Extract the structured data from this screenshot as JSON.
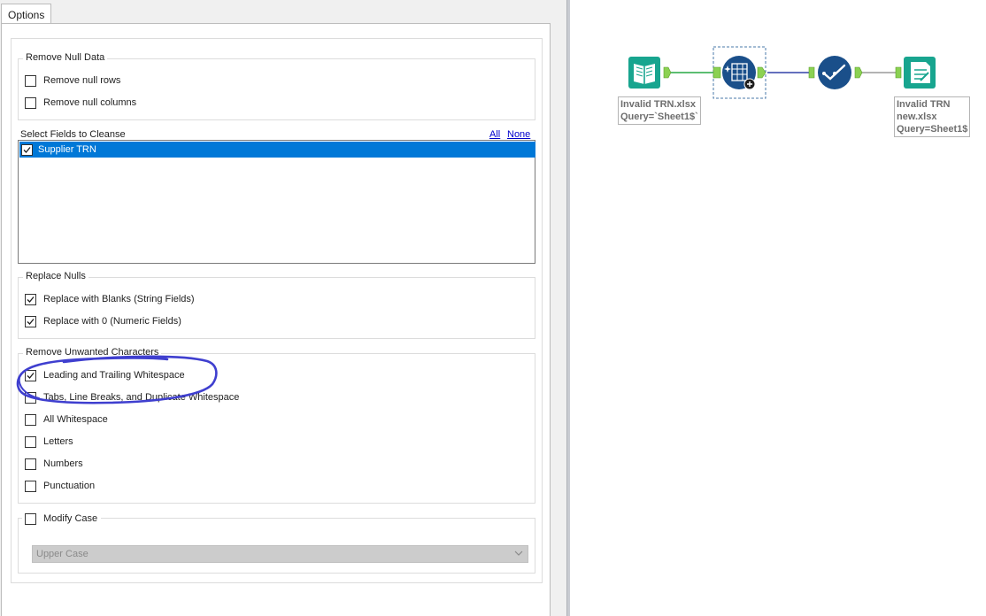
{
  "tabs": {
    "options_label": "Options"
  },
  "remove_null": {
    "title": "Remove Null Data",
    "rows": {
      "label": "Remove null rows",
      "checked": false
    },
    "columns": {
      "label": "Remove null columns",
      "checked": false
    }
  },
  "fields": {
    "label": "Select Fields to Cleanse",
    "all_link": "All",
    "none_link": "None",
    "items": [
      {
        "label": "Supplier TRN",
        "checked": true,
        "selected": true
      }
    ]
  },
  "replace_nulls": {
    "title": "Replace Nulls",
    "blanks": {
      "label": "Replace with Blanks (String Fields)",
      "checked": true
    },
    "zero": {
      "label": "Replace with 0 (Numeric Fields)",
      "checked": true
    }
  },
  "unwanted": {
    "title": "Remove Unwanted Characters",
    "items": [
      {
        "label": "Leading and Trailing Whitespace",
        "checked": true
      },
      {
        "label": "Tabs, Line Breaks, and Duplicate Whitespace",
        "checked": false
      },
      {
        "label": "All Whitespace",
        "checked": false
      },
      {
        "label": "Letters",
        "checked": false
      },
      {
        "label": "Numbers",
        "checked": false
      },
      {
        "label": "Punctuation",
        "checked": false
      }
    ]
  },
  "modify_case": {
    "label": "Modify Case",
    "checked": false,
    "select_value": "Upper Case"
  },
  "workflow": {
    "input_label": [
      "Invalid TRN.xlsx",
      "Query=`Sheet1$`"
    ],
    "output_label": [
      "Invalid TRN",
      "new.xlsx",
      "Query=Sheet1$"
    ]
  },
  "colors": {
    "selection": "#0078d7",
    "link": "#0000cc",
    "annotation": "#3f3fcf",
    "input_tool": "#18a58f",
    "cleanse_tool": "#1a4f8a",
    "output_tool": "#18a58f",
    "connector_green": "#27a844",
    "connector_blue": "#3240a8"
  }
}
